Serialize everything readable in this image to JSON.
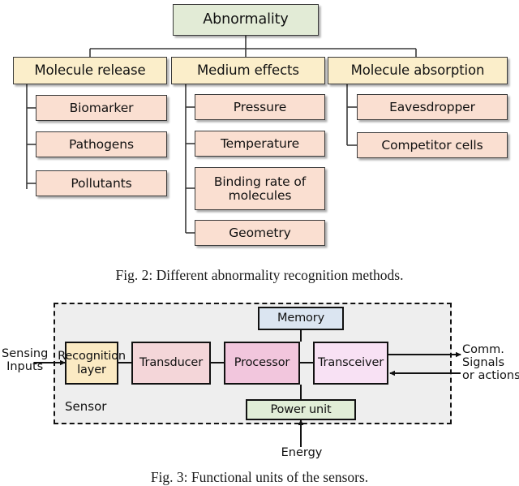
{
  "figure2": {
    "root": {
      "label": "Abnormality"
    },
    "branches": [
      {
        "label": "Molecule release",
        "children": [
          {
            "label": "Biomarker"
          },
          {
            "label": "Pathogens"
          },
          {
            "label": "Pollutants"
          }
        ]
      },
      {
        "label": "Medium effects",
        "children": [
          {
            "label": "Pressure"
          },
          {
            "label": "Temperature"
          },
          {
            "label": "Binding rate of molecules"
          },
          {
            "label": "Geometry"
          }
        ]
      },
      {
        "label": "Molecule absorption",
        "children": [
          {
            "label": "Eavesdropper"
          },
          {
            "label": "Competitor cells"
          }
        ]
      }
    ],
    "caption": "Fig. 2: Different abnormality recognition methods.",
    "colors": {
      "root_fill": "#e2ebd6",
      "branch_fill": "#fbeeca",
      "leaf_fill": "#fadfd1",
      "stroke": "#3a3a3a"
    }
  },
  "figure3": {
    "container_label": "Sensor",
    "blocks": [
      {
        "label": "Recognition layer",
        "fill": "#fbeac3"
      },
      {
        "label": "Transducer",
        "fill": "#f4d6d9"
      },
      {
        "label": "Processor",
        "fill": "#f2c6dd"
      },
      {
        "label": "Transceiver",
        "fill": "#f8e1f4"
      },
      {
        "label": "Memory",
        "fill": "#dbe5f1"
      },
      {
        "label": "Power unit",
        "fill": "#e1eed7"
      }
    ],
    "labels": {
      "input": "Sensing\nInputs",
      "input_line1": "Sensing",
      "input_line2": "Inputs",
      "output_line1": "Comm.",
      "output_line2": "Signals",
      "output_line3": "or actions",
      "energy": "Energy"
    },
    "caption": "Fig. 3: Functional units of the sensors."
  }
}
